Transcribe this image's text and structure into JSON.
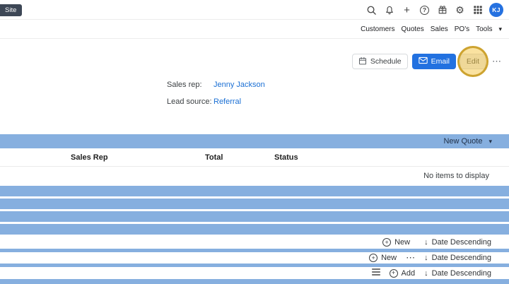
{
  "topbar": {
    "site_badge": "Site",
    "user_initials": "KJ"
  },
  "nav": {
    "items": [
      "Customers",
      "Quotes",
      "Sales",
      "PO's",
      "Tools"
    ]
  },
  "actions": {
    "schedule": "Schedule",
    "email": "Email",
    "edit": "Edit"
  },
  "details": {
    "sales_rep_label": "Sales rep:",
    "sales_rep_value": "Jenny Jackson",
    "lead_source_label": "Lead source:",
    "lead_source_value": "Referral"
  },
  "quotes": {
    "new_button": "New Quote",
    "columns": [
      "Sales Rep",
      "Total",
      "Status"
    ],
    "empty_text": "No items to display"
  },
  "toolbars": [
    {
      "action": "New",
      "sort": "Date Descending"
    },
    {
      "action": "New",
      "more": "⋯",
      "sort": "Date Descending"
    },
    {
      "action": "Add",
      "sort": "Date Descending"
    }
  ],
  "icons": {
    "caret_down": "▾",
    "ellipsis": "⋯",
    "arrow_down": "↓",
    "plus": "+",
    "help": "?",
    "gear": "⚙"
  },
  "colors": {
    "stripe_blue": "#86AFDF",
    "link_blue": "#1A6FD4",
    "email_button_blue": "#2271E0",
    "highlight_yellow": "#F5C641",
    "avatar_blue": "#2571E0",
    "site_badge_dark": "#3D4756"
  }
}
